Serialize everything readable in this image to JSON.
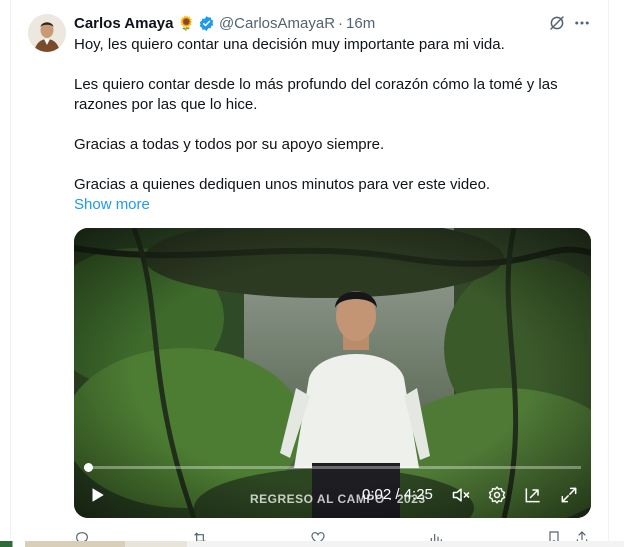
{
  "tweet": {
    "author_name": "Carlos Amaya",
    "flower": "🌻",
    "handle": "@CarlosAmayaR",
    "separator": "·",
    "time": "16m",
    "text_lines": [
      "Hoy, les quiero contar una decisión muy importante para mi vida.",
      "Les quiero contar desde lo más profundo del corazón cómo la tomé y las razones por las que lo hice.",
      "Gracias a todas y todos por su apoyo siempre.",
      "Gracias a quienes dediquen unos minutos para ver este video."
    ],
    "show_more": "Show more"
  },
  "video": {
    "caption": "REGRESO AL CAMPO · 2023",
    "timecode": "0:02 / 4:25",
    "progress_fraction": 0.008
  },
  "icons": {
    "verified": "verified-badge-icon",
    "grok": "grok-icon",
    "more": "more-icon",
    "play": "play-icon",
    "mute": "volume-muted-icon",
    "settings": "settings-icon",
    "pip": "picture-in-picture-icon",
    "fullscreen": "fullscreen-icon"
  },
  "colors": {
    "link": "#1d9bf0",
    "secondary_text": "#536471",
    "verified": "#1d9bf0"
  }
}
